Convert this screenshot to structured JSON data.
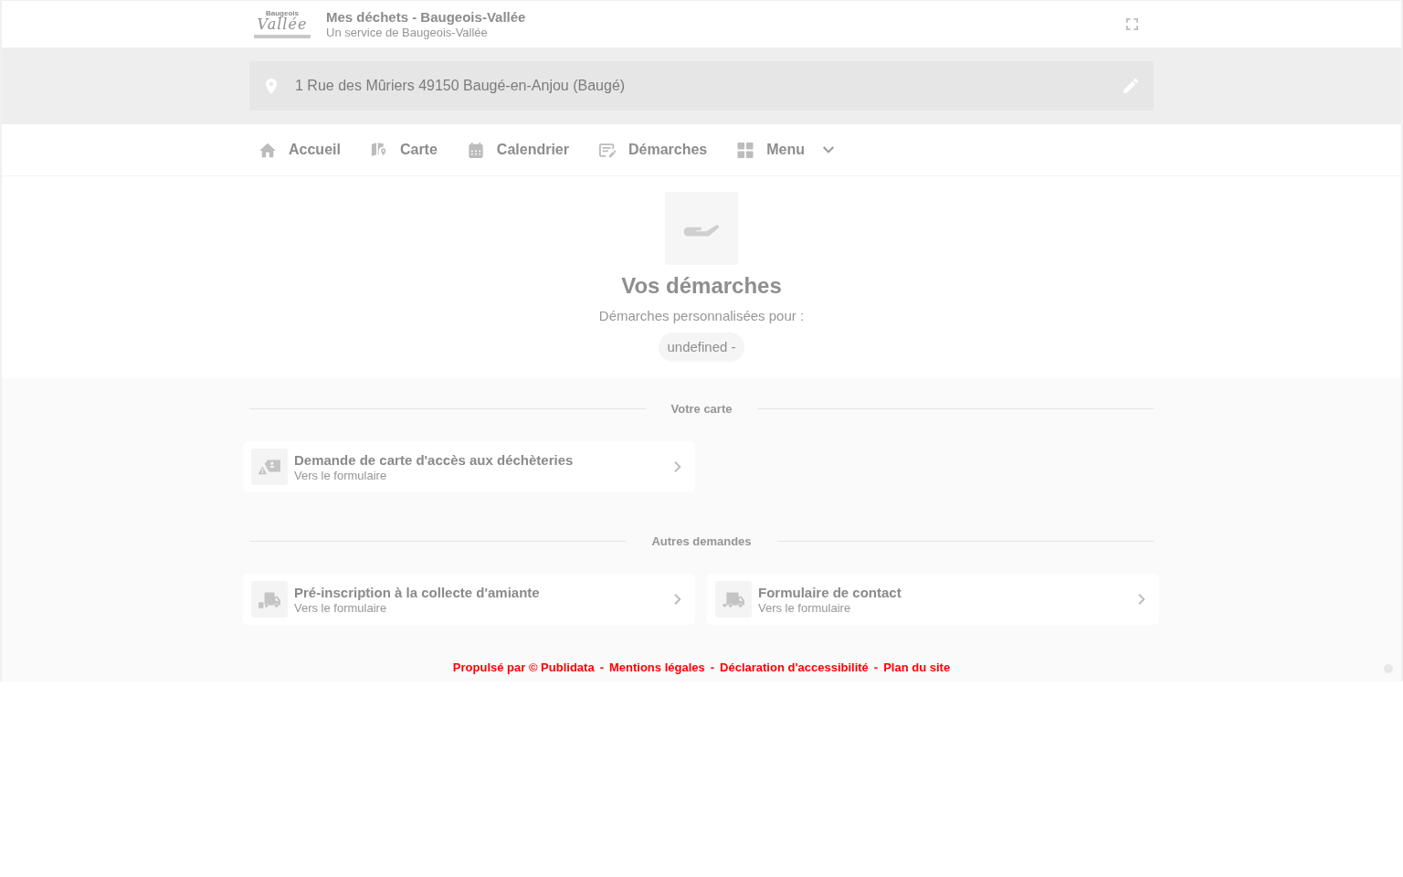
{
  "header": {
    "logo": {
      "name": "Baugeois",
      "script": "Vallée"
    },
    "title": "Mes déchets - Baugeois-Vallée",
    "subtitle": "Un service de Baugeois-Vallée"
  },
  "address": {
    "value": "1 Rue des Mûriers 49150 Baugé-en-Anjou (Baugé)"
  },
  "nav": [
    {
      "label": "Accueil",
      "kind": "link"
    },
    {
      "label": "Carte",
      "kind": "link"
    },
    {
      "label": "Calendrier",
      "kind": "link"
    },
    {
      "label": "Démarches",
      "kind": "link"
    },
    {
      "label": "Menu",
      "kind": "dropdown",
      "expanded": false
    }
  ],
  "hero": {
    "title": "Vos démarches",
    "subtitle": "Démarches personnalisées pour :",
    "chip": "undefined -"
  },
  "sections": [
    {
      "heading": "Votre carte",
      "cards": [
        {
          "title": "Demande de carte d'accès aux déchèteries",
          "link": "Vers le formulaire"
        }
      ]
    },
    {
      "heading": "Autres demandes",
      "cards": [
        {
          "title": "Pré-inscription à la collecte d'amiante",
          "link": "Vers le formulaire"
        },
        {
          "title": "Formulaire de contact",
          "link": "Vers le formulaire"
        }
      ]
    }
  ],
  "footer": {
    "links": [
      "Propulsé par © Publidata",
      "Mentions légales",
      "Déclaration d'accessibilité",
      "Plan du site"
    ],
    "separator": "-"
  }
}
